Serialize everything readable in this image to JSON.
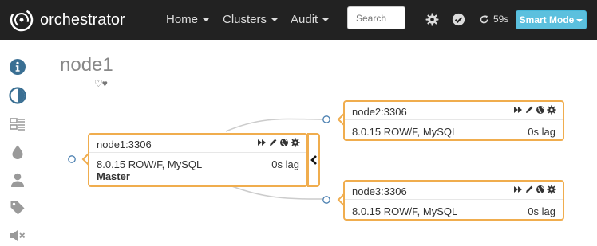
{
  "app": {
    "brand": "orchestrator"
  },
  "nav": {
    "items": [
      {
        "label": "Home"
      },
      {
        "label": "Clusters"
      },
      {
        "label": "Audit"
      }
    ],
    "search_placeholder": "Search",
    "refresh_countdown": "59s",
    "mode_button": "Smart Mode",
    "icons": [
      "gear-icon",
      "check-circle-icon",
      "refresh-icon"
    ]
  },
  "sidebar": {
    "icons": [
      "info-icon",
      "contrast-icon",
      "topology-icon",
      "drop-icon",
      "user-icon",
      "tag-icon",
      "mute-icon"
    ]
  },
  "page": {
    "title": "node1",
    "hearts": "♡♥"
  },
  "colors": {
    "accent": "#f0ad4e",
    "info": "#5bc0de",
    "navbar": "#222222",
    "sidebar_icon": "#3a6f93"
  },
  "topology": {
    "nodes": [
      {
        "name": "node1:3306",
        "version": "8.0.15 ROW/F, MySQL",
        "lag": "0s lag",
        "role": "Master"
      },
      {
        "name": "node2:3306",
        "version": "8.0.15 ROW/F, MySQL",
        "lag": "0s lag"
      },
      {
        "name": "node3:3306",
        "version": "8.0.15 ROW/F, MySQL",
        "lag": "0s lag"
      }
    ]
  }
}
